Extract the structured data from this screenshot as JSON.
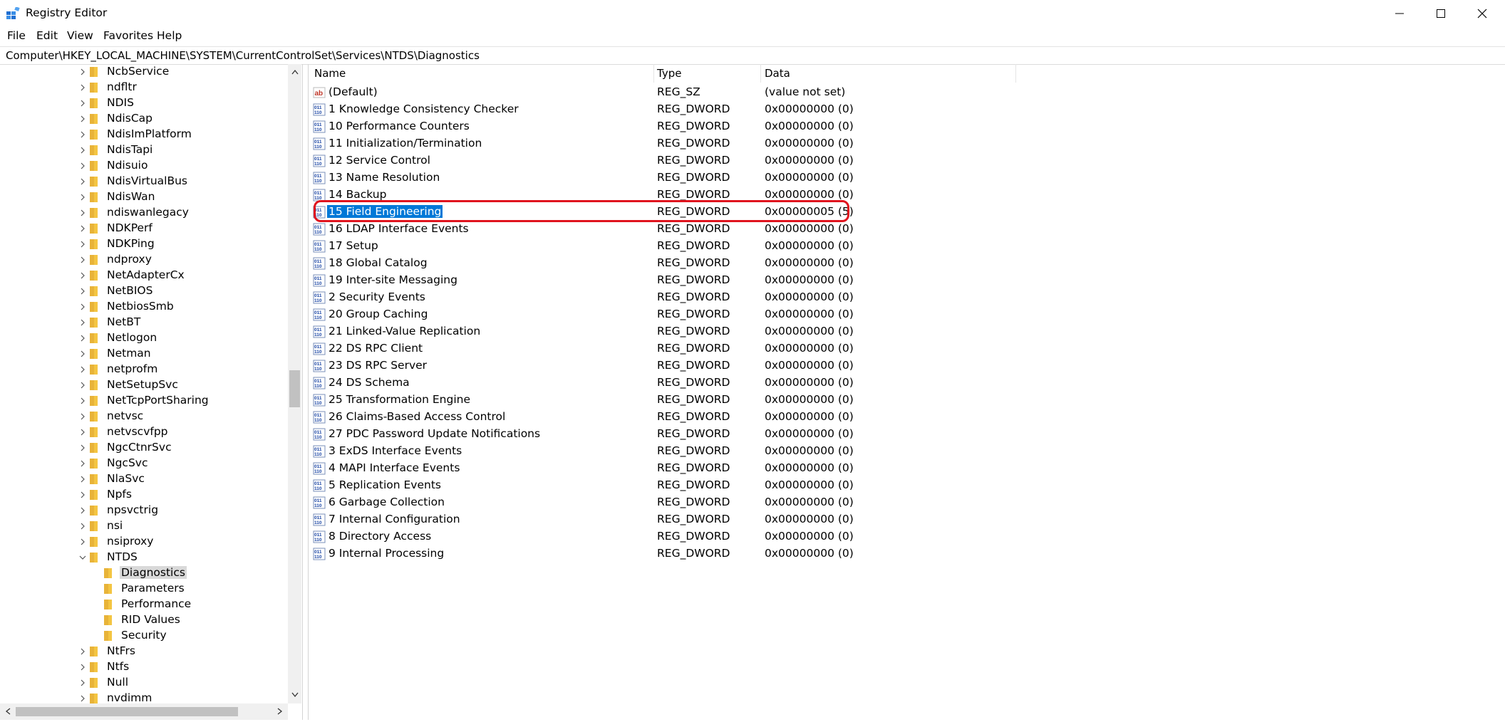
{
  "window": {
    "title": "Registry Editor",
    "buttons": [
      "minimize",
      "maximize",
      "close"
    ]
  },
  "menu": [
    "File",
    "Edit",
    "View",
    "Favorites",
    "Help"
  ],
  "address": "Computer\\HKEY_LOCAL_MACHINE\\SYSTEM\\CurrentControlSet\\Services\\NTDS\\Diagnostics",
  "tree": [
    {
      "label": "NcbService",
      "level": 0,
      "expander": "collapsed"
    },
    {
      "label": "ndfltr",
      "level": 0,
      "expander": "collapsed"
    },
    {
      "label": "NDIS",
      "level": 0,
      "expander": "collapsed"
    },
    {
      "label": "NdisCap",
      "level": 0,
      "expander": "collapsed"
    },
    {
      "label": "NdisImPlatform",
      "level": 0,
      "expander": "collapsed"
    },
    {
      "label": "NdisTapi",
      "level": 0,
      "expander": "collapsed"
    },
    {
      "label": "Ndisuio",
      "level": 0,
      "expander": "collapsed"
    },
    {
      "label": "NdisVirtualBus",
      "level": 0,
      "expander": "collapsed"
    },
    {
      "label": "NdisWan",
      "level": 0,
      "expander": "collapsed"
    },
    {
      "label": "ndiswanlegacy",
      "level": 0,
      "expander": "collapsed"
    },
    {
      "label": "NDKPerf",
      "level": 0,
      "expander": "collapsed"
    },
    {
      "label": "NDKPing",
      "level": 0,
      "expander": "collapsed"
    },
    {
      "label": "ndproxy",
      "level": 0,
      "expander": "collapsed"
    },
    {
      "label": "NetAdapterCx",
      "level": 0,
      "expander": "collapsed"
    },
    {
      "label": "NetBIOS",
      "level": 0,
      "expander": "collapsed"
    },
    {
      "label": "NetbiosSmb",
      "level": 0,
      "expander": "collapsed"
    },
    {
      "label": "NetBT",
      "level": 0,
      "expander": "collapsed"
    },
    {
      "label": "Netlogon",
      "level": 0,
      "expander": "collapsed"
    },
    {
      "label": "Netman",
      "level": 0,
      "expander": "collapsed"
    },
    {
      "label": "netprofm",
      "level": 0,
      "expander": "collapsed"
    },
    {
      "label": "NetSetupSvc",
      "level": 0,
      "expander": "collapsed"
    },
    {
      "label": "NetTcpPortSharing",
      "level": 0,
      "expander": "collapsed"
    },
    {
      "label": "netvsc",
      "level": 0,
      "expander": "collapsed"
    },
    {
      "label": "netvscvfpp",
      "level": 0,
      "expander": "collapsed"
    },
    {
      "label": "NgcCtnrSvc",
      "level": 0,
      "expander": "collapsed"
    },
    {
      "label": "NgcSvc",
      "level": 0,
      "expander": "collapsed"
    },
    {
      "label": "NlaSvc",
      "level": 0,
      "expander": "collapsed"
    },
    {
      "label": "Npfs",
      "level": 0,
      "expander": "collapsed"
    },
    {
      "label": "npsvctrig",
      "level": 0,
      "expander": "collapsed"
    },
    {
      "label": "nsi",
      "level": 0,
      "expander": "collapsed"
    },
    {
      "label": "nsiproxy",
      "level": 0,
      "expander": "collapsed"
    },
    {
      "label": "NTDS",
      "level": 0,
      "expander": "expanded"
    },
    {
      "label": "Diagnostics",
      "level": 1,
      "expander": "none",
      "selected": true
    },
    {
      "label": "Parameters",
      "level": 1,
      "expander": "none"
    },
    {
      "label": "Performance",
      "level": 1,
      "expander": "none"
    },
    {
      "label": "RID Values",
      "level": 1,
      "expander": "none"
    },
    {
      "label": "Security",
      "level": 1,
      "expander": "none"
    },
    {
      "label": "NtFrs",
      "level": 0,
      "expander": "collapsed"
    },
    {
      "label": "Ntfs",
      "level": 0,
      "expander": "collapsed"
    },
    {
      "label": "Null",
      "level": 0,
      "expander": "collapsed"
    },
    {
      "label": "nvdimm",
      "level": 0,
      "expander": "collapsed"
    }
  ],
  "columns": {
    "name": "Name",
    "type": "Type",
    "data": "Data"
  },
  "values": [
    {
      "name": "(Default)",
      "type": "REG_SZ",
      "data": "(value not set)",
      "icon": "string-value-icon"
    },
    {
      "name": "1 Knowledge Consistency Checker",
      "type": "REG_DWORD",
      "data": "0x00000000 (0)",
      "icon": "binary-value-icon"
    },
    {
      "name": "10 Performance Counters",
      "type": "REG_DWORD",
      "data": "0x00000000 (0)",
      "icon": "binary-value-icon"
    },
    {
      "name": "11 Initialization/Termination",
      "type": "REG_DWORD",
      "data": "0x00000000 (0)",
      "icon": "binary-value-icon"
    },
    {
      "name": "12 Service Control",
      "type": "REG_DWORD",
      "data": "0x00000000 (0)",
      "icon": "binary-value-icon"
    },
    {
      "name": "13 Name Resolution",
      "type": "REG_DWORD",
      "data": "0x00000000 (0)",
      "icon": "binary-value-icon"
    },
    {
      "name": "14 Backup",
      "type": "REG_DWORD",
      "data": "0x00000000 (0)",
      "icon": "binary-value-icon"
    },
    {
      "name": "15 Field Engineering",
      "type": "REG_DWORD",
      "data": "0x00000005 (5)",
      "icon": "binary-value-icon",
      "selected": true
    },
    {
      "name": "16 LDAP Interface Events",
      "type": "REG_DWORD",
      "data": "0x00000000 (0)",
      "icon": "binary-value-icon"
    },
    {
      "name": "17 Setup",
      "type": "REG_DWORD",
      "data": "0x00000000 (0)",
      "icon": "binary-value-icon"
    },
    {
      "name": "18 Global Catalog",
      "type": "REG_DWORD",
      "data": "0x00000000 (0)",
      "icon": "binary-value-icon"
    },
    {
      "name": "19 Inter-site Messaging",
      "type": "REG_DWORD",
      "data": "0x00000000 (0)",
      "icon": "binary-value-icon"
    },
    {
      "name": "2 Security Events",
      "type": "REG_DWORD",
      "data": "0x00000000 (0)",
      "icon": "binary-value-icon"
    },
    {
      "name": "20 Group Caching",
      "type": "REG_DWORD",
      "data": "0x00000000 (0)",
      "icon": "binary-value-icon"
    },
    {
      "name": "21 Linked-Value Replication",
      "type": "REG_DWORD",
      "data": "0x00000000 (0)",
      "icon": "binary-value-icon"
    },
    {
      "name": "22 DS RPC Client",
      "type": "REG_DWORD",
      "data": "0x00000000 (0)",
      "icon": "binary-value-icon"
    },
    {
      "name": "23 DS RPC Server",
      "type": "REG_DWORD",
      "data": "0x00000000 (0)",
      "icon": "binary-value-icon"
    },
    {
      "name": "24 DS Schema",
      "type": "REG_DWORD",
      "data": "0x00000000 (0)",
      "icon": "binary-value-icon"
    },
    {
      "name": "25 Transformation Engine",
      "type": "REG_DWORD",
      "data": "0x00000000 (0)",
      "icon": "binary-value-icon"
    },
    {
      "name": "26 Claims-Based Access Control",
      "type": "REG_DWORD",
      "data": "0x00000000 (0)",
      "icon": "binary-value-icon"
    },
    {
      "name": "27 PDC Password Update Notifications",
      "type": "REG_DWORD",
      "data": "0x00000000 (0)",
      "icon": "binary-value-icon"
    },
    {
      "name": "3 ExDS Interface Events",
      "type": "REG_DWORD",
      "data": "0x00000000 (0)",
      "icon": "binary-value-icon"
    },
    {
      "name": "4 MAPI Interface Events",
      "type": "REG_DWORD",
      "data": "0x00000000 (0)",
      "icon": "binary-value-icon"
    },
    {
      "name": "5 Replication Events",
      "type": "REG_DWORD",
      "data": "0x00000000 (0)",
      "icon": "binary-value-icon"
    },
    {
      "name": "6 Garbage Collection",
      "type": "REG_DWORD",
      "data": "0x00000000 (0)",
      "icon": "binary-value-icon"
    },
    {
      "name": "7 Internal Configuration",
      "type": "REG_DWORD",
      "data": "0x00000000 (0)",
      "icon": "binary-value-icon"
    },
    {
      "name": "8 Directory Access",
      "type": "REG_DWORD",
      "data": "0x00000000 (0)",
      "icon": "binary-value-icon"
    },
    {
      "name": "9 Internal Processing",
      "type": "REG_DWORD",
      "data": "0x00000000 (0)",
      "icon": "binary-value-icon"
    }
  ],
  "colors": {
    "selection": "#0078d7",
    "tree_selection": "#d9d9d9",
    "annotation": "#e0141e",
    "folder": "#f4c542"
  }
}
